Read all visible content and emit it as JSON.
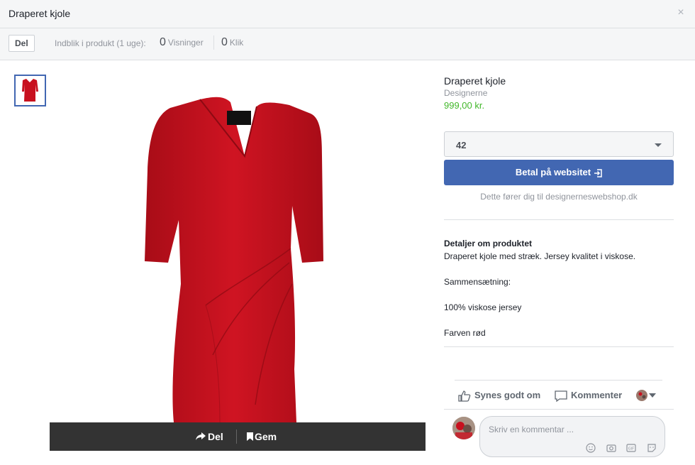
{
  "header": {
    "title": "Draperet kjole",
    "close": "×"
  },
  "subbar": {
    "share": "Del",
    "insight": "Indblik i produkt (1 uge):",
    "views_count": "0",
    "views_label": "Visninger",
    "clicks_count": "0",
    "clicks_label": "Klik"
  },
  "image_bar": {
    "share": "Del",
    "save": "Gem"
  },
  "product": {
    "title": "Draperet kjole",
    "seller": "Designerne",
    "price": "999,00 kr.",
    "size_selected": "42",
    "pay_button": "Betal på websitet",
    "pay_note": "Dette fører dig til designerneswebshop.dk"
  },
  "details": {
    "title": "Detaljer om produktet",
    "lines": [
      "Draperet kjole med stræk. Jersey kvalitet i viskose.",
      "Sammensætning:",
      "100% viskose jersey",
      "Farven rød"
    ]
  },
  "actions": {
    "like": "Synes godt om",
    "comment": "Kommenter"
  },
  "comment_box": {
    "placeholder": "Skriv en kommentar ..."
  },
  "colors": {
    "accent": "#4267b2",
    "price": "#42b72a",
    "dress": "#c8101e"
  }
}
